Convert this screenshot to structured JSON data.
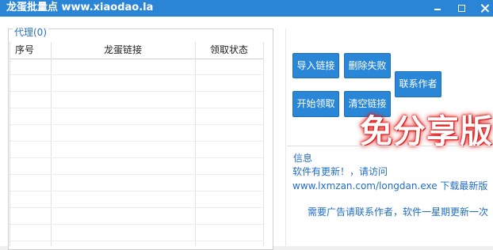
{
  "window": {
    "title": "龙蛋批量点 www.xiaodao.la",
    "controls": {
      "minimize": "minimize-icon",
      "maximize": "maximize-icon",
      "close": "close-icon"
    }
  },
  "proxy_panel": {
    "title": "代理(0)",
    "columns": [
      "序号",
      "龙蛋链接",
      "领取状态"
    ],
    "rows": []
  },
  "buttons": {
    "import": "导入链接",
    "delete_failed": "删除失败",
    "contact_author": "联系作者",
    "start_claim": "开始领取",
    "clear_links": "清空链接"
  },
  "promo": {
    "text": "免分享版",
    "color": "#e21a1a"
  },
  "info": {
    "title": "信息",
    "line1": "软件有更新！，请访问",
    "line2": "www.lxmzan.com/longdan.exe 下载最新版",
    "line3": "需要广告请联系作者，软件一星期更新一次"
  },
  "colors": {
    "titlebar": "#2a85d6",
    "button": "#2a87d8",
    "link_text": "#1f6ec6"
  }
}
